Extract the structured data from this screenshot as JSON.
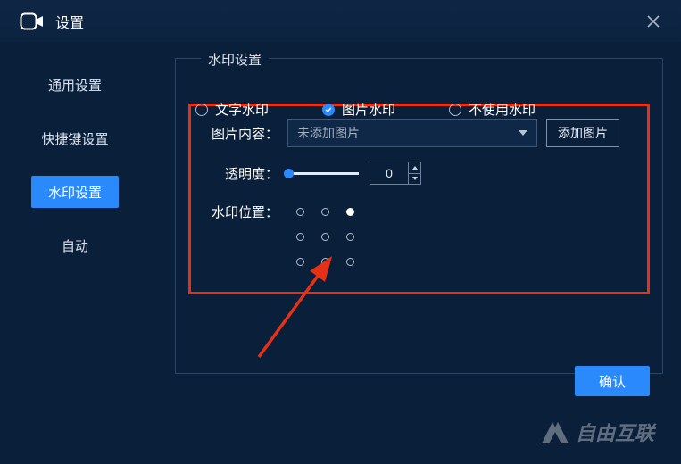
{
  "titlebar": {
    "title": "设置"
  },
  "sidebar": {
    "items": [
      {
        "label": "通用设置",
        "active": false
      },
      {
        "label": "快捷键设置",
        "active": false
      },
      {
        "label": "水印设置",
        "active": true
      },
      {
        "label": "自动",
        "active": false
      }
    ]
  },
  "panel": {
    "legend": "水印设置",
    "radios": {
      "text": "文字水印",
      "image": "图片水印",
      "none": "不使用水印",
      "selected": "image"
    },
    "image_row": {
      "label": "图片内容：",
      "selected": "未添加图片",
      "add_btn": "添加图片"
    },
    "opacity_row": {
      "label": "透明度：",
      "value": "0"
    },
    "position_row": {
      "label": "水印位置：",
      "selected_index": 2
    }
  },
  "footer": {
    "confirm": "确认"
  },
  "branding": {
    "text": "自由互联"
  }
}
